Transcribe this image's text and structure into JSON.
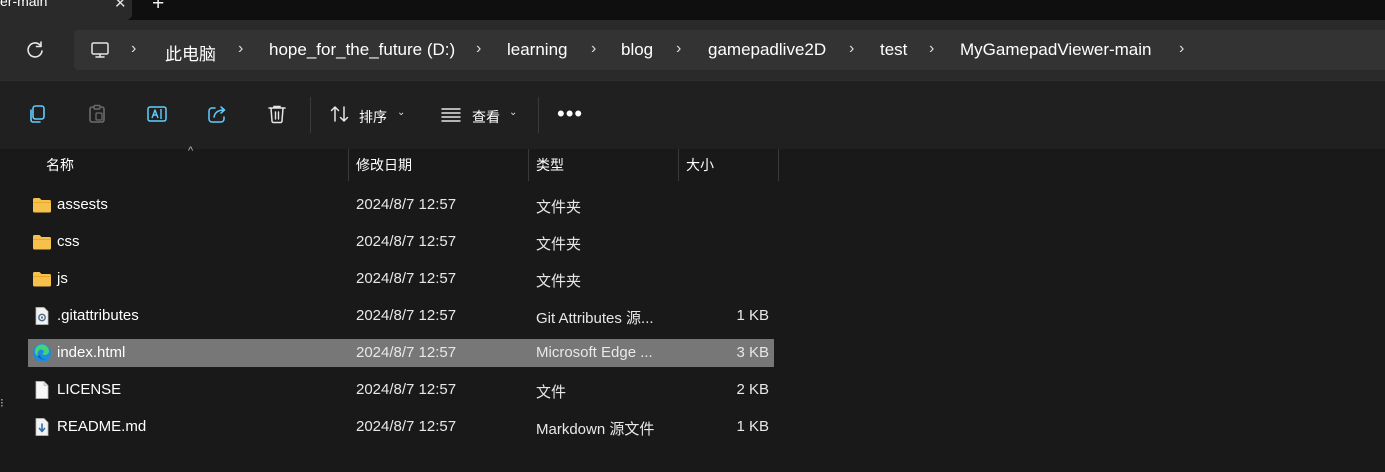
{
  "tab": {
    "title": "er-main",
    "close": "✕",
    "new": "+"
  },
  "breadcrumb": {
    "items": [
      "此电脑",
      "hope_for_the_future (D:)",
      "learning",
      "blog",
      "gamepadlive2D",
      "test",
      "MyGamepadViewer-main"
    ],
    "separator": "›"
  },
  "toolbar": {
    "sort_label": "排序",
    "view_label": "查看",
    "more_label": "•••",
    "caret": "⌄"
  },
  "columns": {
    "name": "名称",
    "date": "修改日期",
    "type": "类型",
    "size": "大小"
  },
  "files": [
    {
      "name": "assests",
      "date": "2024/8/7 12:57",
      "type": "文件夹",
      "size": "",
      "icon": "folder-icon"
    },
    {
      "name": "css",
      "date": "2024/8/7 12:57",
      "type": "文件夹",
      "size": "",
      "icon": "folder-icon"
    },
    {
      "name": "js",
      "date": "2024/8/7 12:57",
      "type": "文件夹",
      "size": "",
      "icon": "folder-icon"
    },
    {
      "name": ".gitattributes",
      "date": "2024/8/7 12:57",
      "type": "Git Attributes 源...",
      "size": "1 KB",
      "icon": "config-file-icon"
    },
    {
      "name": "index.html",
      "date": "2024/8/7 12:57",
      "type": "Microsoft Edge ...",
      "size": "3 KB",
      "icon": "edge-icon",
      "selected": true
    },
    {
      "name": "LICENSE",
      "date": "2024/8/7 12:57",
      "type": "文件",
      "size": "2 KB",
      "icon": "blank-file-icon"
    },
    {
      "name": "README.md",
      "date": "2024/8/7 12:57",
      "type": "Markdown 源文件",
      "size": "1 KB",
      "icon": "markdown-file-icon"
    }
  ],
  "colors": {
    "background": "#191919",
    "toolbar": "#202020",
    "address": "#333333",
    "selected_row": "#777777",
    "folder": "#f6c04d",
    "accent": "#60cdff"
  }
}
